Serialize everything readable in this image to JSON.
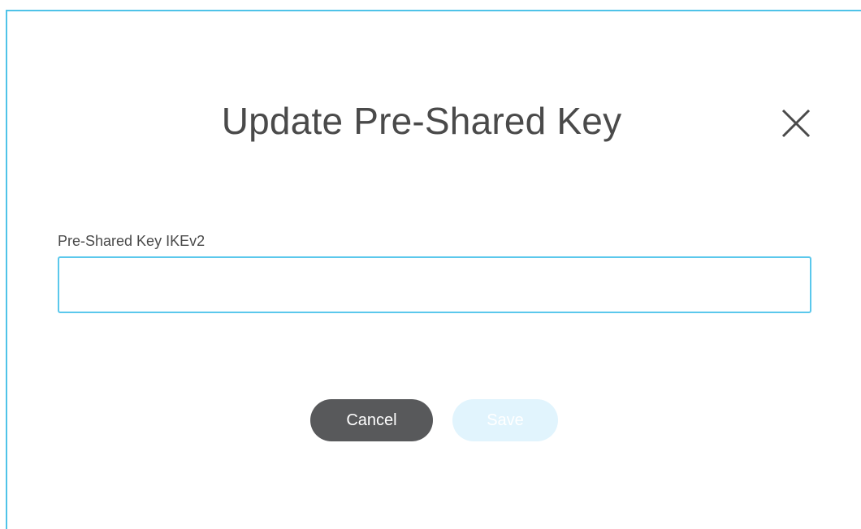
{
  "dialog": {
    "title": "Update Pre-Shared Key",
    "close_icon": "close-icon",
    "field": {
      "label": "Pre-Shared Key IKEv2",
      "value": "",
      "placeholder": ""
    },
    "buttons": {
      "cancel_label": "Cancel",
      "save_label": "Save",
      "save_disabled": true
    }
  },
  "colors": {
    "accent": "#4fc3e8",
    "title_text": "#4a4a4a",
    "cancel_bg": "#58595b",
    "save_bg_disabled": "#e1f4fd"
  }
}
